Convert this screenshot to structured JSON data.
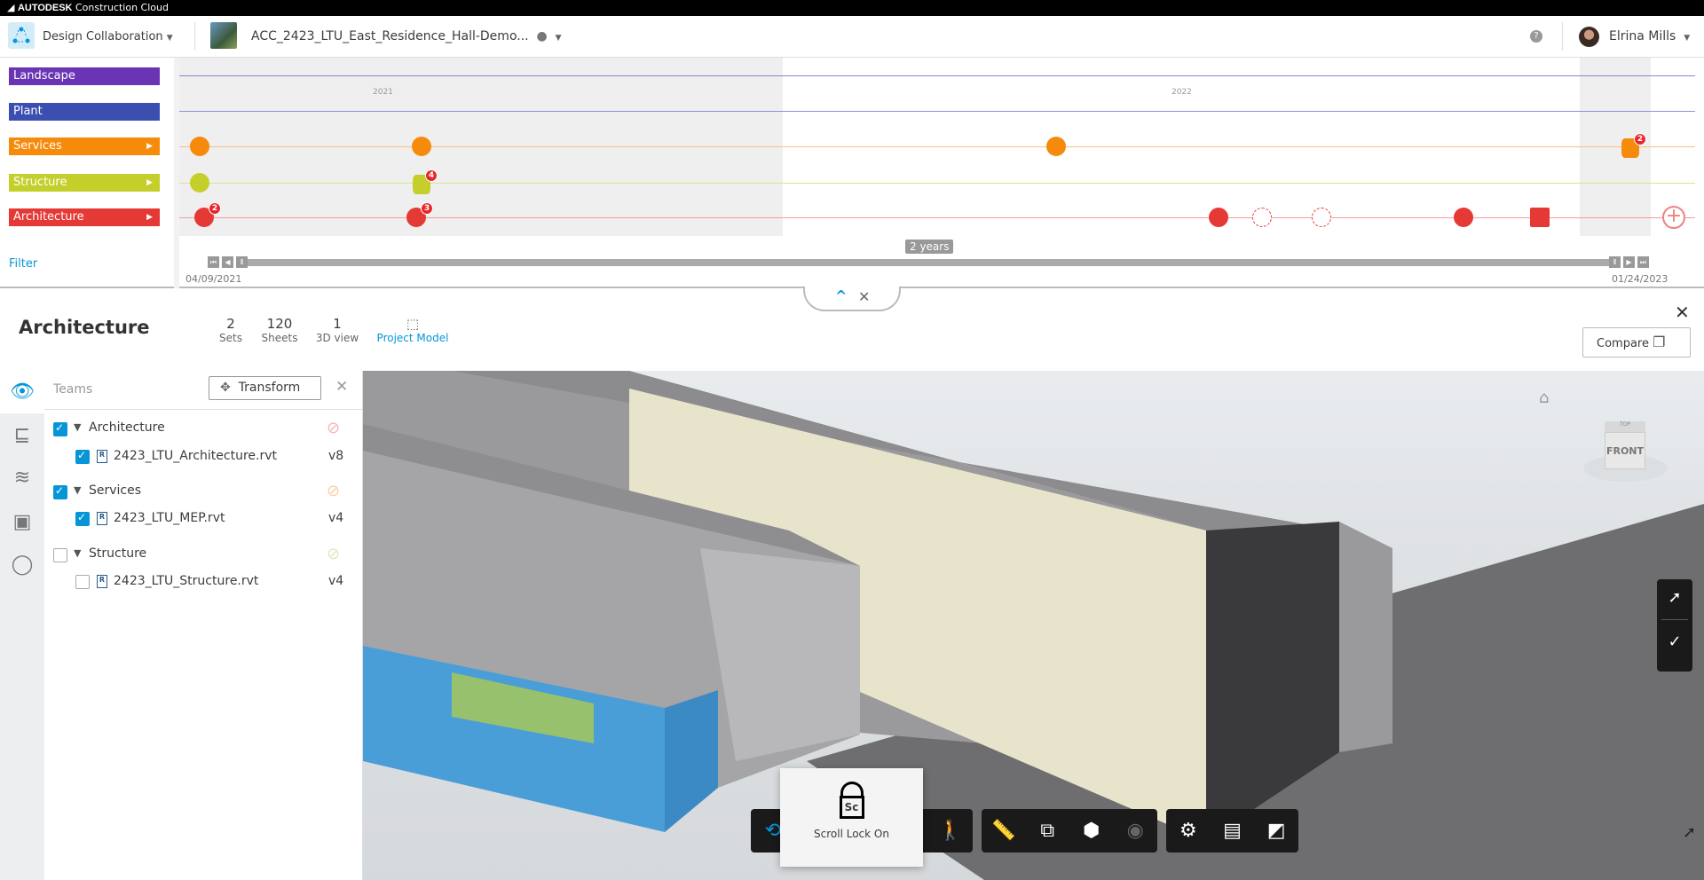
{
  "topbar": {
    "brand": "AUTODESK",
    "product": "Construction Cloud"
  },
  "header": {
    "module": "Design Collaboration",
    "project": "ACC_2423_LTU_East_Residence_Hall-Demo...",
    "user": "Elrina Mills",
    "help": "?"
  },
  "timeline": {
    "teams": [
      {
        "label": "Landscape",
        "color": "#6a35b5",
        "expandable": false
      },
      {
        "label": "Plant",
        "color": "#3a4fb0",
        "expandable": false
      },
      {
        "label": "Services",
        "color": "#f68a0b",
        "expandable": true
      },
      {
        "label": "Structure",
        "color": "#c5cf2c",
        "expandable": true
      },
      {
        "label": "Architecture",
        "color": "#e53935",
        "expandable": true
      }
    ],
    "years": [
      "2021",
      "2022"
    ],
    "badges": {
      "services_last": "2",
      "structure_second": "4",
      "arch_first": "2",
      "arch_second": "3"
    },
    "filter": "Filter",
    "range_label": "2 years",
    "start_date": "04/09/2021",
    "end_date": "01/24/2023",
    "arrow": "▶"
  },
  "details": {
    "title": "Architecture",
    "stats": [
      {
        "value": "2",
        "label": "Sets"
      },
      {
        "value": "120",
        "label": "Sheets"
      },
      {
        "value": "1",
        "label": "3D view"
      }
    ],
    "project_model": "Project Model",
    "compare": "Compare"
  },
  "panel": {
    "title": "Teams",
    "transform": "Transform",
    "groups": [
      {
        "name": "Architecture",
        "checked": true,
        "file": "2423_LTU_Architecture.rvt",
        "version": "v8",
        "color": "#f4b6b6"
      },
      {
        "name": "Services",
        "checked": true,
        "file": "2423_LTU_MEP.rvt",
        "version": "v4",
        "color": "#f9cfa0"
      },
      {
        "name": "Structure",
        "checked": false,
        "file": "2423_LTU_Structure.rvt",
        "version": "v4",
        "color": "#e2e8b8"
      }
    ]
  },
  "viewer": {
    "viewcube_face": "FRONT",
    "viewcube_top": "TOP",
    "tooltip": "Scroll Lock On",
    "tooltip_icon": "Sc"
  }
}
